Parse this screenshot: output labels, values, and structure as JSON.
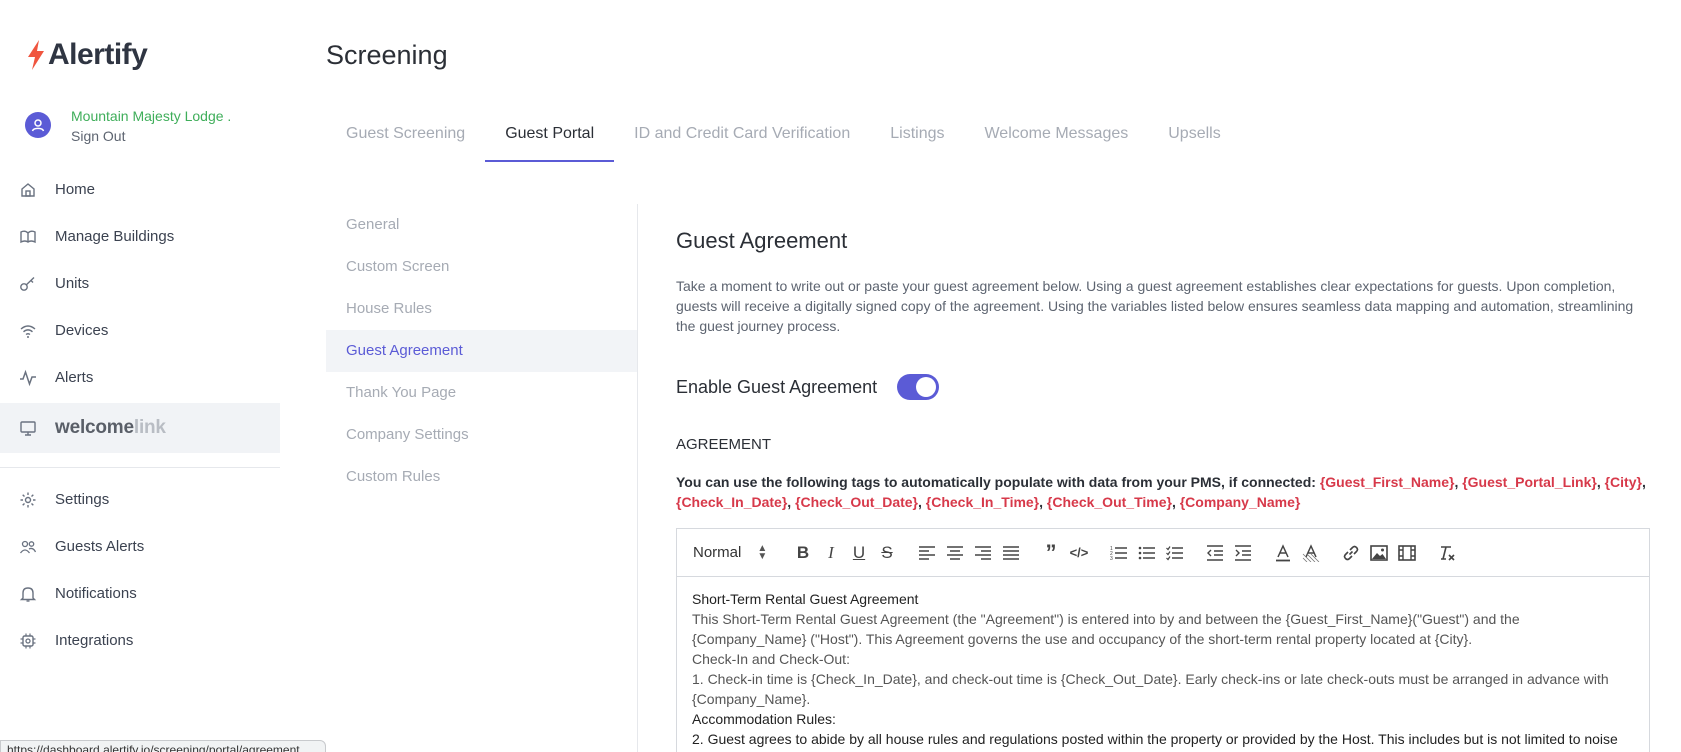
{
  "app": {
    "logo_text": "Alertify",
    "brand_color": "#5b5bd6",
    "accent_green": "#3fae5a",
    "tag_color": "#d7394a"
  },
  "account": {
    "name": "Mountain Majesty Lodge .",
    "signout": "Sign Out"
  },
  "sidebar": {
    "items": [
      {
        "label": "Home",
        "icon": "home-icon"
      },
      {
        "label": "Manage Buildings",
        "icon": "book-icon"
      },
      {
        "label": "Units",
        "icon": "key-icon"
      },
      {
        "label": "Devices",
        "icon": "wifi-icon"
      },
      {
        "label": "Alerts",
        "icon": "pulse-icon"
      }
    ],
    "active_item": {
      "label_main": "welcome",
      "label_accent": "link",
      "icon": "monitor-icon"
    },
    "bottom_items": [
      {
        "label": "Settings",
        "icon": "gear-icon"
      },
      {
        "label": "Guests Alerts",
        "icon": "users-icon"
      },
      {
        "label": "Notifications",
        "icon": "bell-icon"
      },
      {
        "label": "Integrations",
        "icon": "chip-icon"
      }
    ]
  },
  "header": {
    "title": "Screening",
    "tabs": [
      {
        "label": "Guest Screening"
      },
      {
        "label": "Guest Portal"
      },
      {
        "label": "ID and Credit Card Verification"
      },
      {
        "label": "Listings"
      },
      {
        "label": "Welcome Messages"
      },
      {
        "label": "Upsells"
      }
    ],
    "active_tab": "Guest Portal"
  },
  "submenu": {
    "items": [
      {
        "label": "General"
      },
      {
        "label": "Custom Screen"
      },
      {
        "label": "House Rules"
      },
      {
        "label": "Guest Agreement"
      },
      {
        "label": "Thank You Page"
      },
      {
        "label": "Company Settings"
      },
      {
        "label": "Custom Rules"
      }
    ],
    "active_item": "Guest Agreement"
  },
  "main": {
    "title": "Guest Agreement",
    "description": "Take a moment to write out or paste your guest agreement below. Using a guest agreement establishes clear expectations for guests. Upon completion, guests will receive a digitally signed copy of the agreement. Using the variables listed below ensures seamless data mapping and automation, streamlining the guest journey process.",
    "enable_label": "Enable Guest Agreement",
    "enabled": true,
    "agreement_label": "AGREEMENT",
    "tags_intro": "You can use the following tags to automatically populate with data from your PMS, if connected:",
    "tags": [
      "{Guest_First_Name}",
      "{Guest_Portal_Link}",
      "{City}",
      "{Check_In_Date}",
      "{Check_Out_Date}",
      "{Check_In_Time}",
      "{Check_Out_Time}",
      "{Company_Name}"
    ]
  },
  "editor": {
    "format_value": "Normal",
    "toolbar_icons": [
      "bold-icon",
      "italic-icon",
      "underline-icon",
      "strike-icon",
      "align-left-icon",
      "align-center-icon",
      "align-right-icon",
      "align-justify-icon",
      "quote-icon",
      "code-icon",
      "ordered-list-icon",
      "bullet-list-icon",
      "check-list-icon",
      "outdent-icon",
      "indent-icon",
      "text-color-icon",
      "background-color-icon",
      "link-icon",
      "image-icon",
      "video-icon",
      "clear-format-icon"
    ],
    "lines": [
      "Short-Term Rental Guest Agreement",
      "This Short-Term Rental Guest Agreement (the \"Agreement\") is entered into by and between the {Guest_First_Name}(\"Guest\") and the {Company_Name} (\"Host\"). This Agreement governs the use and occupancy of the short-term rental property located at {City}.",
      "Check-In and Check-Out:",
      "1. Check-in time is {Check_In_Date}, and check-out time is {Check_Out_Date}. Early check-ins or late check-outs must be arranged in advance with {Company_Name}.",
      "Accommodation Rules:",
      "2. Guest agrees to abide by all house rules and regulations posted within the property or provided by the Host. This includes but is not limited to noise"
    ]
  },
  "status_bar": {
    "url": "https://dashboard.alertify.io/screening/portal/agreement"
  }
}
